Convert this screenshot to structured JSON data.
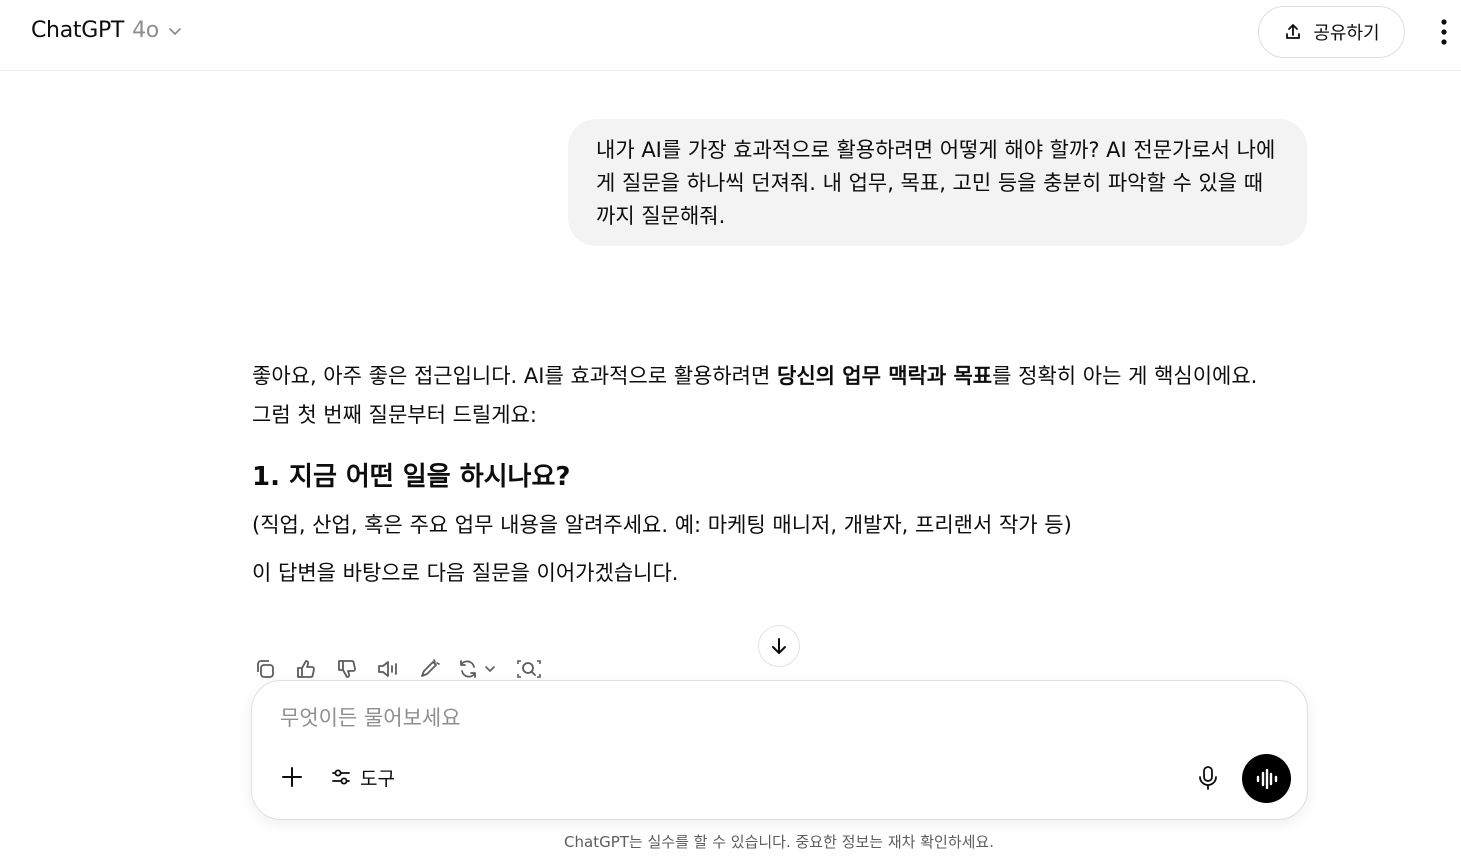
{
  "header": {
    "model_name": "ChatGPT",
    "model_version": "4o",
    "share_label": "공유하기"
  },
  "conversation": {
    "user_message": "내가 AI를 가장 효과적으로 활용하려면 어떻게 해야 할까? AI 전문가로서 나에게 질문을 하나씩 던져줘. 내 업무, 목표, 고민 등을 충분히 파악할 수 있을 때까지 질문해줘.",
    "assistant": {
      "intro_before": "좋아요, 아주 좋은 접근입니다. AI를 효과적으로 활용하려면 ",
      "intro_bold": "당신의 업무 맥락과 목표",
      "intro_after": "를 정확히 아는 게 핵심이에요.",
      "lead_in": "그럼 첫 번째 질문부터 드릴게요:",
      "question_heading": "1. 지금 어떤 일을 하시나요?",
      "question_hint": "(직업, 산업, 혹은 주요 업무 내용을 알려주세요. 예: 마케팅 매니저, 개발자, 프리랜서 작가 등)",
      "closing": "이 답변을 바탕으로 다음 질문을 이어가겠습니다."
    },
    "action_icons": [
      "copy-icon",
      "thumbs-up-icon",
      "thumbs-down-icon",
      "read-aloud-icon",
      "edit-canvas-icon",
      "regenerate-icon",
      "search-icon"
    ]
  },
  "composer": {
    "placeholder": "무엇이든 물어보세요",
    "tools_label": "도구"
  },
  "footer": {
    "disclaimer": "ChatGPT는 실수를 할 수 있습니다. 중요한 정보는 재차 확인하세요."
  },
  "colors": {
    "user_bubble_bg": "#f3f3f3",
    "voice_button_bg": "#000000",
    "text": "#0d0d0d",
    "muted_text": "#8e8e8e"
  }
}
